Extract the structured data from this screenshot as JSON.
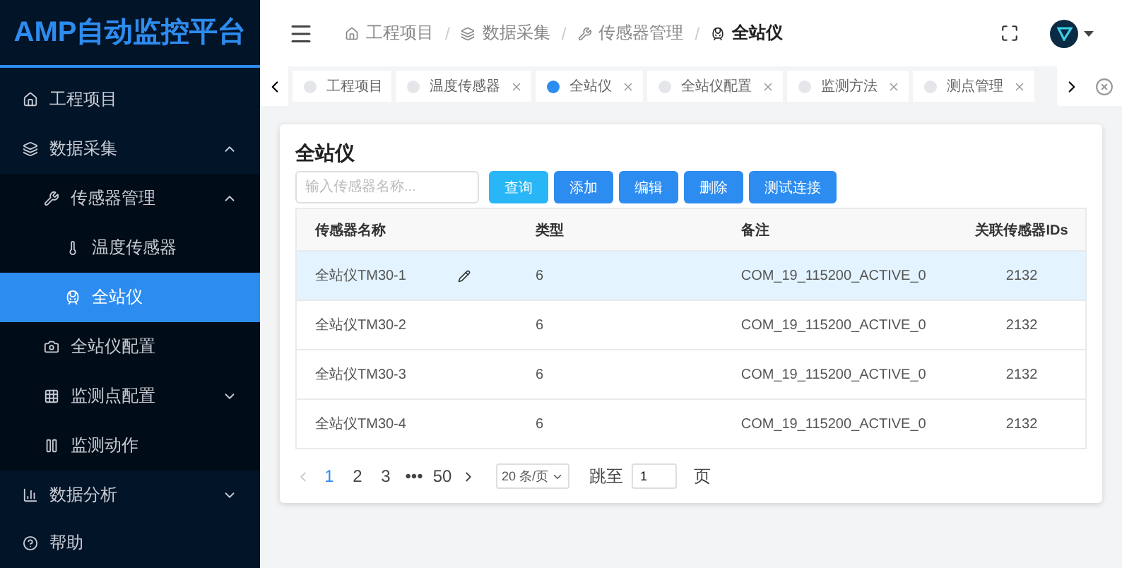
{
  "logo": "AMP自动监控平台",
  "sidebar": {
    "items": [
      {
        "label": "工程项目",
        "kind": "home",
        "selected": false
      },
      {
        "label": "数据采集",
        "kind": "layers",
        "selected": false,
        "expanded": true,
        "children": [
          {
            "label": "传感器管理",
            "kind": "wrench",
            "selected": false,
            "expanded": true,
            "children": [
              {
                "label": "温度传感器",
                "kind": "thermometer",
                "selected": false
              },
              {
                "label": "全站仪",
                "kind": "device",
                "selected": true
              }
            ]
          },
          {
            "label": "全站仪配置",
            "kind": "camera",
            "selected": false
          },
          {
            "label": "监测点配置",
            "kind": "grid",
            "selected": false,
            "expanded": false
          },
          {
            "label": "监测动作",
            "kind": "pause",
            "selected": false
          }
        ]
      },
      {
        "label": "数据分析",
        "kind": "chart",
        "selected": false,
        "expanded": false
      },
      {
        "label": "帮助",
        "kind": "help",
        "selected": false
      }
    ]
  },
  "breadcrumb": [
    {
      "label": "工程项目",
      "kind": "home"
    },
    {
      "separator": "/"
    },
    {
      "label": "数据采集",
      "kind": "layers"
    },
    {
      "separator": "/"
    },
    {
      "label": "传感器管理",
      "kind": "wrench"
    },
    {
      "separator": "/"
    },
    {
      "label": "全站仪",
      "kind": "device"
    }
  ],
  "tabs": [
    {
      "label": "工程项目",
      "selected": false,
      "closable": false
    },
    {
      "label": "温度传感器",
      "selected": false,
      "closable": true
    },
    {
      "label": "全站仪",
      "selected": true,
      "closable": true
    },
    {
      "label": "全站仪配置",
      "selected": false,
      "closable": true
    },
    {
      "label": "监测方法",
      "selected": false,
      "closable": true
    },
    {
      "label": "测点管理",
      "selected": false,
      "closable": true
    }
  ],
  "card": {
    "title": "全站仪",
    "search": {
      "placeholder": "输入传感器名称..."
    },
    "buttons": [
      {
        "label": "查询",
        "kind": "query"
      },
      {
        "label": "添加",
        "kind": "primary"
      },
      {
        "label": "编辑",
        "kind": "primary"
      },
      {
        "label": "删除",
        "kind": "primary"
      },
      {
        "label": "测试连接",
        "kind": "primary"
      }
    ],
    "table": {
      "columns": [
        "传感器名称",
        "类型",
        "备注",
        "关联传感器IDs"
      ],
      "rows": [
        {
          "selected": true,
          "cells": [
            "全站仪TM30-1",
            "6",
            "COM_19_115200_ACTIVE_0",
            "2132"
          ]
        },
        {
          "selected": false,
          "cells": [
            "全站仪TM30-2",
            "6",
            "COM_19_115200_ACTIVE_0",
            "2132"
          ]
        },
        {
          "selected": false,
          "cells": [
            "全站仪TM30-3",
            "6",
            "COM_19_115200_ACTIVE_0",
            "2132"
          ]
        },
        {
          "selected": false,
          "cells": [
            "全站仪TM30-4",
            "6",
            "COM_19_115200_ACTIVE_0",
            "2132"
          ]
        }
      ]
    },
    "pagination": {
      "pages": [
        {
          "label": "1",
          "selected": true
        },
        {
          "label": "2",
          "selected": false
        },
        {
          "label": "3",
          "selected": false
        },
        {
          "label": "•••",
          "selected": false
        },
        {
          "label": "50",
          "selected": false
        }
      ],
      "prev_disabled": true,
      "page_size": "20 条/页",
      "jump_label": "跳至",
      "jump_value": "1",
      "page_suffix": "页"
    }
  }
}
